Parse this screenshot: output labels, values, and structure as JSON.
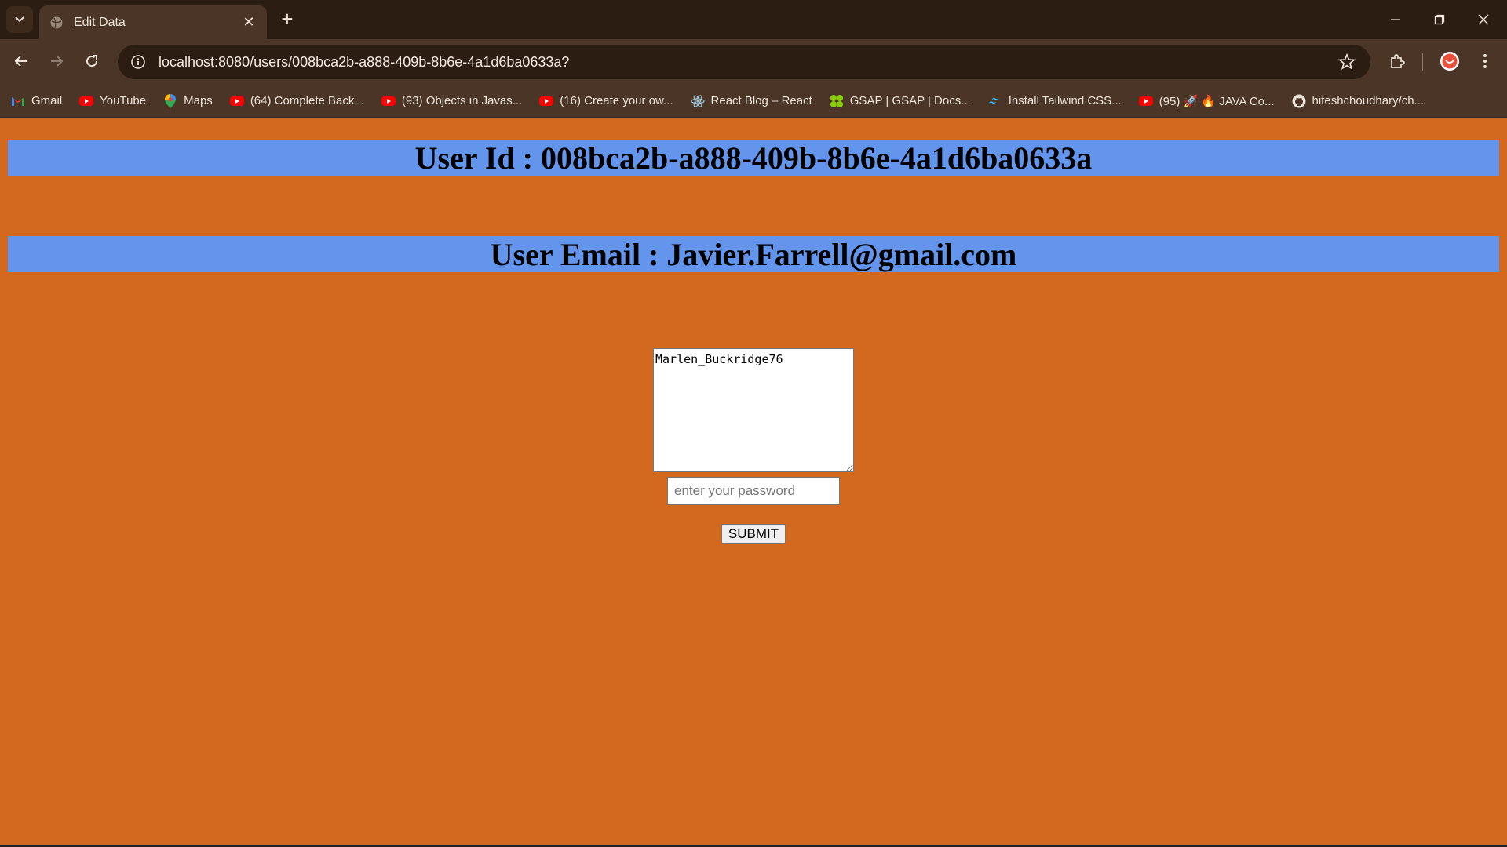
{
  "browser": {
    "tab_title": "Edit Data",
    "url": "localhost:8080/users/008bca2b-a888-409b-8b6e-4a1d6ba0633a?",
    "bookmarks": [
      {
        "label": "Gmail",
        "icon": "gmail-icon"
      },
      {
        "label": "YouTube",
        "icon": "youtube-icon"
      },
      {
        "label": "Maps",
        "icon": "maps-icon"
      },
      {
        "label": "(64) Complete Back...",
        "icon": "youtube-icon"
      },
      {
        "label": "(93) Objects in Javas...",
        "icon": "youtube-icon"
      },
      {
        "label": "(16) Create your ow...",
        "icon": "youtube-icon"
      },
      {
        "label": "React Blog – React",
        "icon": "react-icon"
      },
      {
        "label": "GSAP | GSAP | Docs...",
        "icon": "gsap-icon"
      },
      {
        "label": "Install Tailwind CSS...",
        "icon": "tailwind-icon"
      },
      {
        "label": "(95) 🚀 🔥 JAVA Co...",
        "icon": "youtube-icon"
      },
      {
        "label": "hiteshchoudhary/ch...",
        "icon": "github-icon"
      }
    ]
  },
  "page": {
    "user_id_heading": "User Id : 008bca2b-a888-409b-8b6e-4a1d6ba0633a",
    "user_email_heading": "User Email : Javier.Farrell@gmail.com",
    "username_value": "Marlen_Buckridge76",
    "password_placeholder": "enter your password",
    "submit_label": "SUBMIT"
  },
  "colors": {
    "page_background": "#d2691e",
    "banner_background": "#6495ed"
  }
}
